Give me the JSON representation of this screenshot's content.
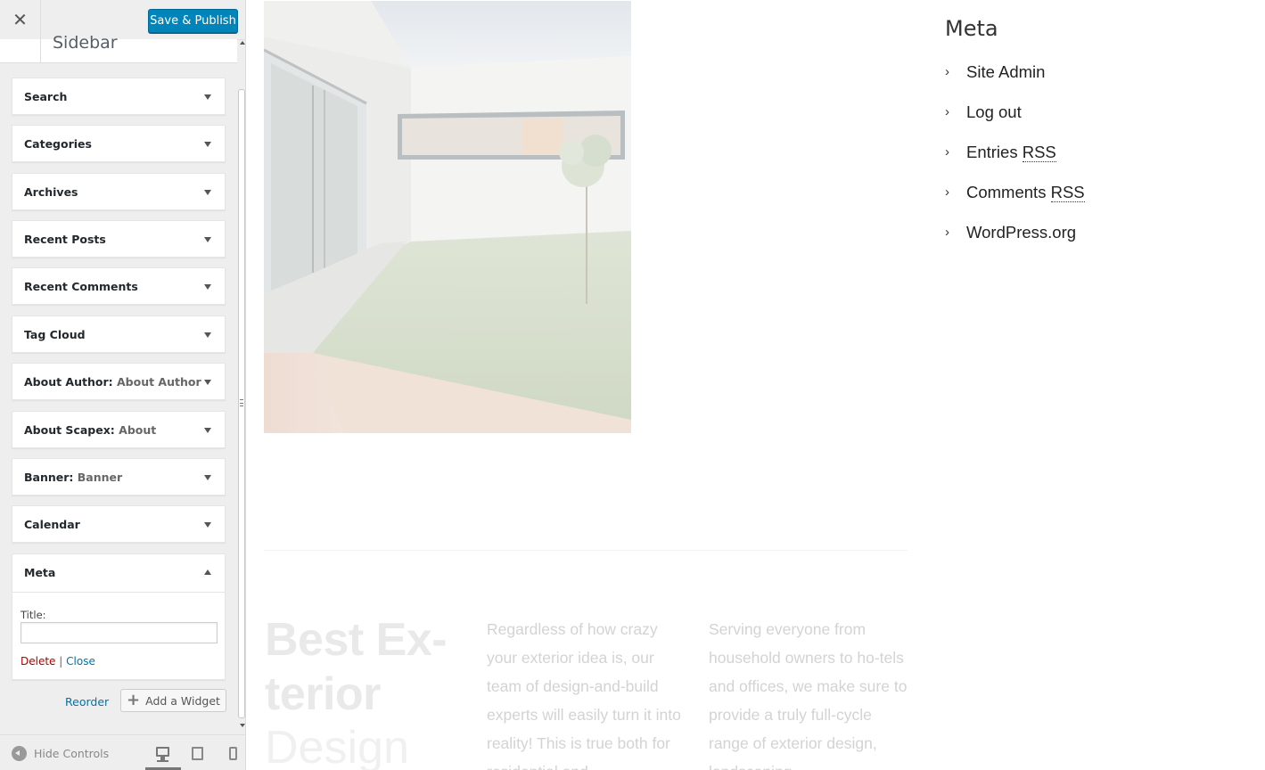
{
  "customizer": {
    "close_icon": "close-icon",
    "save_label": "Save & Publish",
    "section_title": "Sidebar",
    "widgets": [
      {
        "title": "Search",
        "subtitle": ""
      },
      {
        "title": "Categories",
        "subtitle": ""
      },
      {
        "title": "Archives",
        "subtitle": ""
      },
      {
        "title": "Recent Posts",
        "subtitle": ""
      },
      {
        "title": "Recent Comments",
        "subtitle": ""
      },
      {
        "title": "Tag Cloud",
        "subtitle": ""
      },
      {
        "title": "About Author:",
        "subtitle": "About Author"
      },
      {
        "title": "About Scapex:",
        "subtitle": "About"
      },
      {
        "title": "Banner:",
        "subtitle": "Banner"
      },
      {
        "title": "Calendar",
        "subtitle": ""
      }
    ],
    "meta_widget": {
      "title": "Meta",
      "title_label": "Title:",
      "title_value": "",
      "delete_label": "Delete",
      "separator": "|",
      "close_label": "Close"
    },
    "reorder_label": "Reorder",
    "add_widget_label": "Add a Widget",
    "footer": {
      "hide_controls_label": "Hide Controls",
      "devices": [
        "desktop",
        "tablet",
        "mobile"
      ],
      "active_device": "desktop"
    }
  },
  "preview": {
    "meta": {
      "heading": "Meta",
      "items": [
        {
          "label": "Site Admin"
        },
        {
          "label": "Log out"
        },
        {
          "label": "Entries ",
          "abbr": "RSS"
        },
        {
          "label": "Comments ",
          "abbr": "RSS"
        },
        {
          "label": "WordPress.org"
        }
      ]
    },
    "feature": {
      "heading_line1": "Best Ex-terior",
      "heading_line2": "Design",
      "col1": "Regardless of how crazy your exterior idea is, our team of design-and-build experts will easily turn it into reality! This is true both for residential and",
      "col2": "Serving everyone from household owners to ho-tels and offices, we make sure to provide a truly full-cycle range of exterior design, landscaping"
    }
  },
  "colors": {
    "primary_button": "#0085ba",
    "delete_link": "#aa0000",
    "link": "#0073aa",
    "faded_text": "#d3d3d3"
  }
}
